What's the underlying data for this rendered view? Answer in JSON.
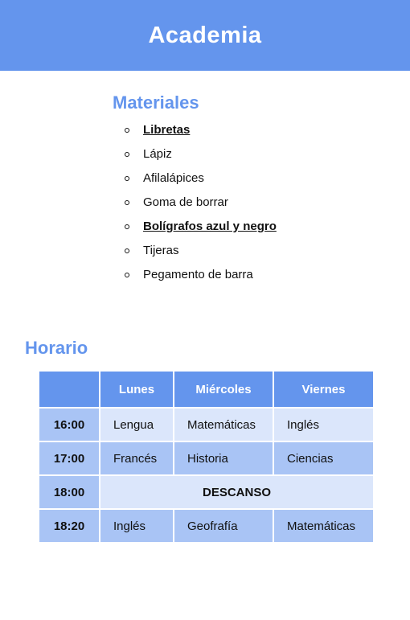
{
  "header": {
    "title": "Academia"
  },
  "materials": {
    "title": "Materiales",
    "items": [
      {
        "label": "Libretas",
        "important": true
      },
      {
        "label": "Lápiz",
        "important": false
      },
      {
        "label": "Afilalápices",
        "important": false
      },
      {
        "label": "Goma de borrar",
        "important": false
      },
      {
        "label": "Bolígrafos azul y negro",
        "important": true
      },
      {
        "label": "Tijeras",
        "important": false
      },
      {
        "label": "Pegamento de barra",
        "important": false
      }
    ]
  },
  "schedule": {
    "title": "Horario",
    "columns": [
      "",
      "Lunes",
      "Miércoles",
      "Viernes"
    ],
    "rows": [
      {
        "time": "16:00",
        "cells": [
          "Lengua",
          "Matemáticas",
          "Inglés"
        ]
      },
      {
        "time": "17:00",
        "cells": [
          "Francés",
          "Historia",
          "Ciencias"
        ]
      },
      {
        "time": "18:00",
        "break": "DESCANSO"
      },
      {
        "time": "18:20",
        "cells": [
          "Inglés",
          "Geofrafía",
          "Matemáticas"
        ]
      }
    ]
  },
  "colors": {
    "accent": "#6495ed",
    "cell_light": "#dbe6fb",
    "cell_mid": "#a9c4f5"
  }
}
